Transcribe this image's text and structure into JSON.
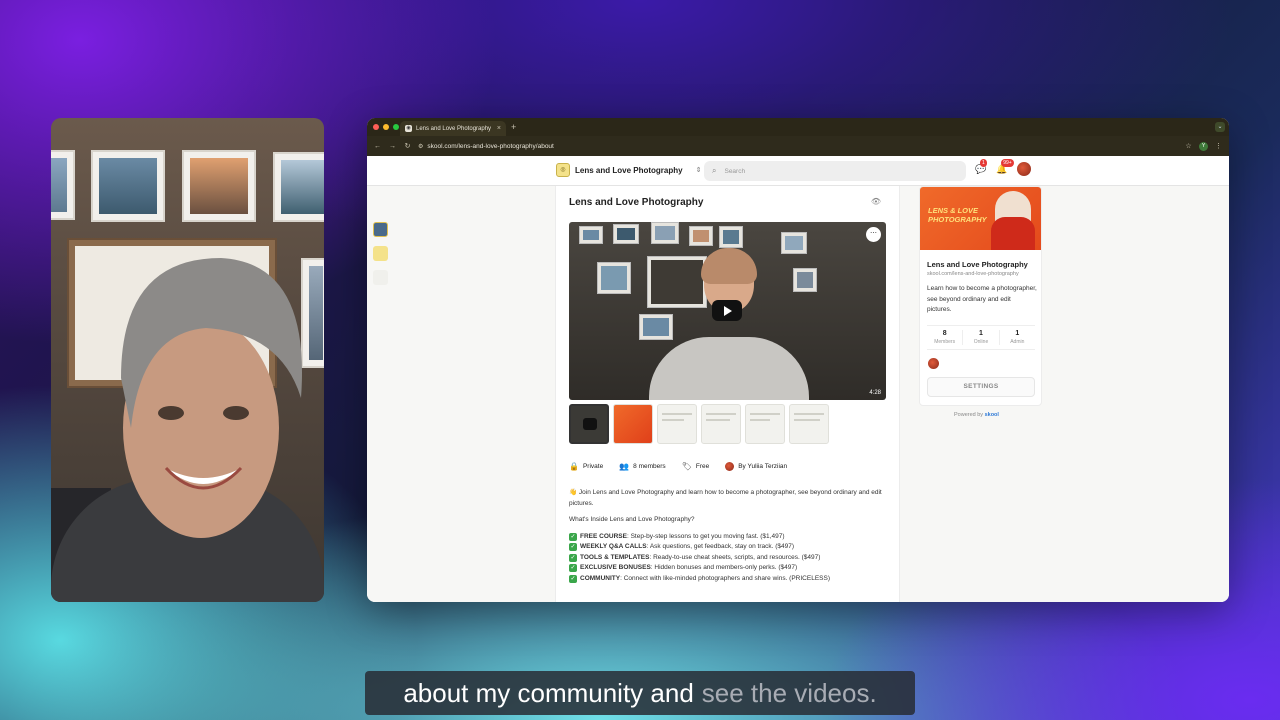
{
  "caption": {
    "spoken": "about my community and",
    "upcoming": "see the videos."
  },
  "browser": {
    "tab_title": "Lens and Love Photography",
    "tab_close": "×",
    "new_tab": "+",
    "url": "skool.com/lens-and-love-photography/about",
    "profile_letter": "Y"
  },
  "topnav": {
    "brand_name": "Lens and Love Photography",
    "search_placeholder": "Search",
    "chat_badge": "1",
    "notif_badge": "99+"
  },
  "main": {
    "title": "Lens and Love Photography",
    "video_duration": "4:28",
    "meta": {
      "privacy": "Private",
      "members": "8 members",
      "price": "Free",
      "author": "By Yuliia Terziian"
    },
    "intro": "👋 Join Lens and Love Photography and learn how to become a photographer, see beyond ordinary and edit pictures.",
    "whats_inside": "What's Inside Lens and Love Photography?",
    "features": [
      {
        "name": "FREE COURSE",
        "text": ": Step-by-step lessons to get you moving fast. ($1,497)"
      },
      {
        "name": "WEEKLY Q&A CALLS",
        "text": ": Ask questions, get feedback, stay on track. ($497)"
      },
      {
        "name": "TOOLS & TEMPLATES",
        "text": ": Ready-to-use cheat sheets, scripts, and resources. ($497)"
      },
      {
        "name": "EXCLUSIVE BONUSES",
        "text": ": Hidden bonuses and members-only perks. ($497)"
      },
      {
        "name": "COMMUNITY",
        "text": ": Connect with like-minded photographers and share wins. (PRICELESS)"
      }
    ]
  },
  "sidecard": {
    "cover_text_1": "LENS & LOVE",
    "cover_text_2": "PHOTOGRAPHY",
    "name": "Lens and Love Photography",
    "url": "skool.com/lens-and-love-photography",
    "description": "Learn how to become a photographer, see beyond ordinary and edit pictures.",
    "stats": [
      {
        "value": "8",
        "label": "Members"
      },
      {
        "value": "1",
        "label": "Online"
      },
      {
        "value": "1",
        "label": "Admin"
      }
    ],
    "settings_label": "SETTINGS",
    "powered_by": "Powered by",
    "powered_brand": "skool"
  },
  "colors": {
    "accent": "#e44a1c",
    "check_green": "#3aa64a",
    "badge_red": "#e53935"
  },
  "icons": {
    "search": "search-icon",
    "chat": "chat-icon",
    "bell": "bell-icon",
    "eye": "eye-icon",
    "lock": "lock-icon",
    "people": "people-icon",
    "tag": "tag-icon"
  }
}
